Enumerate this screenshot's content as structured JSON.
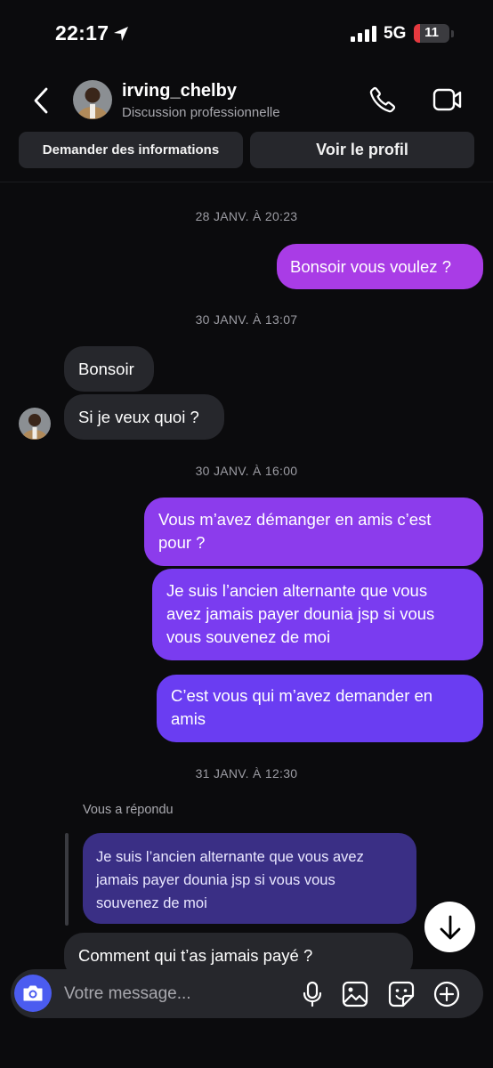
{
  "status": {
    "time": "22:17",
    "network": "5G",
    "battery": "11",
    "battery_fraction": 0.18
  },
  "header": {
    "username": "irving_chelby",
    "subtitle": "Discussion professionnelle"
  },
  "actions": {
    "info_label": "Demander des informations",
    "profile_label": "Voir le profil"
  },
  "timestamps": [
    "28 JANV. À 20:23",
    "30 JANV. À 13:07",
    "30 JANV. À 16:00",
    "31 JANV. À 12:30"
  ],
  "messages": {
    "m1": "Bonsoir vous voulez ?",
    "m2": "Bonsoir",
    "m3": "Si je veux quoi ?",
    "m4": [
      "Vous m’avez démanger en amis c’est",
      "pour ?"
    ],
    "m5": [
      "Je suis l’ancien alternante que vous",
      "avez jamais payer dounia jsp si vous",
      "vous souvenez de moi"
    ],
    "m6": [
      "C’est vous qui m’avez demander en",
      "amis"
    ],
    "reply_label": "Vous a répondu",
    "quote": [
      "Je suis l’ancien alternante que vous avez",
      "jamais payer dounia jsp si vous vous",
      "souvenez de moi"
    ],
    "m7": "Comment qui t’as jamais payé ?"
  },
  "composer": {
    "placeholder": "Votre message..."
  },
  "colors": {
    "outgoing_top": "#a93ce6",
    "outgoing_mid": "#7f3bef",
    "outgoing_bottom": "#6a3df2",
    "incoming": "#26272c",
    "quote": "#3a2f85",
    "camera": "#4b5cf0"
  },
  "icons": [
    "location-arrow-icon",
    "signal-icon",
    "back-chevron-icon",
    "phone-icon",
    "video-camera-icon",
    "arrow-down-icon",
    "camera-icon",
    "microphone-icon",
    "image-icon",
    "sticker-icon",
    "plus-icon"
  ]
}
